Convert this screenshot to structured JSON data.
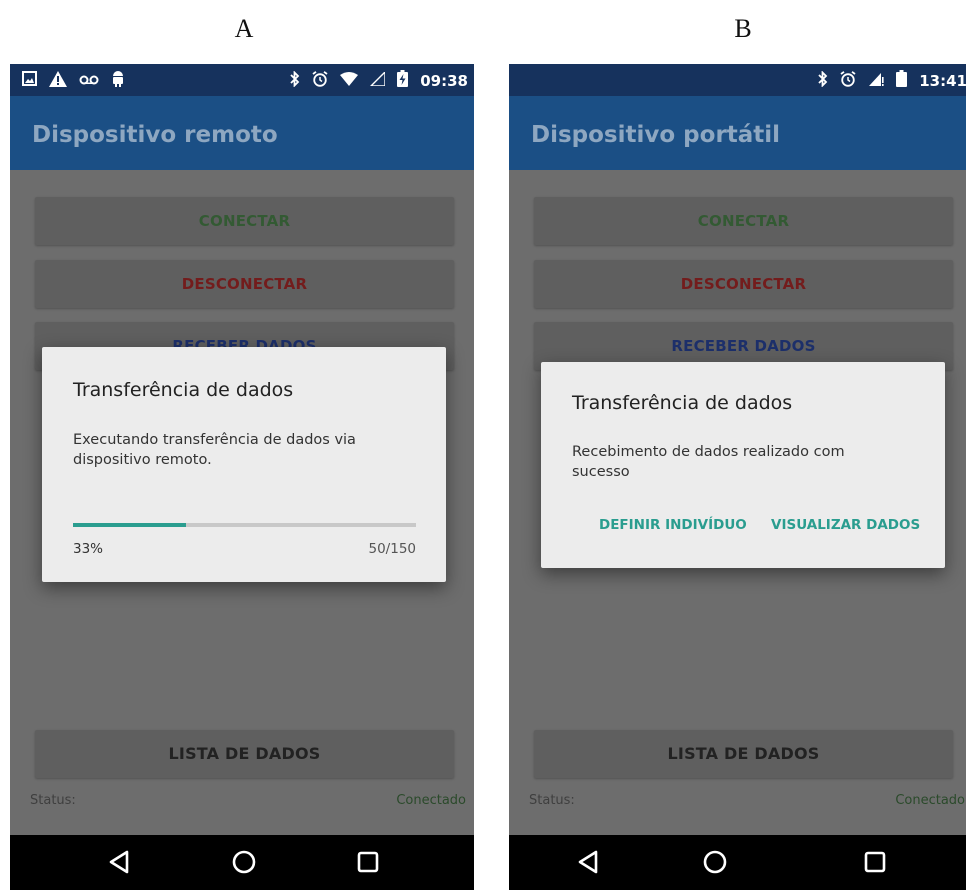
{
  "labels": {
    "a": "A",
    "b": "B"
  },
  "screen_a": {
    "status_time": "09:38",
    "app_title": "Dispositivo remoto",
    "buttons": {
      "connect": "CONECTAR",
      "disconnect": "DESCONECTAR",
      "receive": "RECEBER DADOS",
      "list": "LISTA DE DADOS"
    },
    "status_label": "Status:",
    "status_value": "Conectado",
    "dialog": {
      "title": "Transferência de dados",
      "message": "Executando transferência de dados via dispositivo remoto.",
      "progress_fraction": 0.33,
      "progress_percent": "33%",
      "progress_count": "50/150"
    }
  },
  "screen_b": {
    "status_time": "13:41",
    "app_title": "Dispositivo portátil",
    "buttons": {
      "connect": "CONECTAR",
      "disconnect": "DESCONECTAR",
      "receive": "RECEBER DADOS",
      "list": "LISTA DE DADOS"
    },
    "status_label": "Status:",
    "status_value": "Conectado",
    "dialog": {
      "title": "Transferência de dados",
      "message": "Recebimento de dados realizado com sucesso",
      "action_define": "DEFINIR INDIVÍDUO",
      "action_view": "VISUALIZAR DADOS"
    }
  },
  "colors": {
    "accent": "#2a9d8f",
    "appbar": "#1b4f85",
    "statusbar": "#16325d"
  },
  "icons": {
    "status_a": [
      "image-icon",
      "warning-icon",
      "voicemail-icon",
      "android-icon",
      "bluetooth-icon",
      "alarm-icon",
      "wifi-icon",
      "signal-icon",
      "battery-charging-icon"
    ],
    "status_b": [
      "bluetooth-icon",
      "alarm-icon",
      "signal-icon",
      "battery-icon"
    ],
    "nav": [
      "back-icon",
      "home-icon",
      "recents-icon"
    ]
  }
}
